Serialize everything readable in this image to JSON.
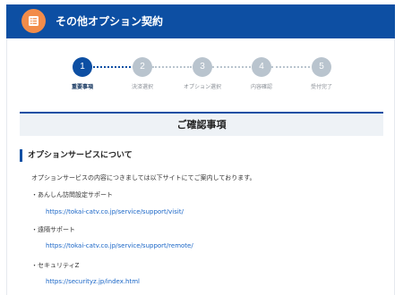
{
  "header": {
    "title": "その他オプション契約",
    "icon": "list-icon",
    "accent": "#0d4fa3",
    "icon_bg": "#f28c4a"
  },
  "steps": [
    {
      "number": "1",
      "label": "重要事項",
      "active": true
    },
    {
      "number": "2",
      "label": "決済選択",
      "active": false
    },
    {
      "number": "3",
      "label": "オプション選択",
      "active": false
    },
    {
      "number": "4",
      "label": "内容確認",
      "active": false
    },
    {
      "number": "5",
      "label": "受付完了",
      "active": false
    }
  ],
  "confirm": {
    "title": "ご確認事項"
  },
  "section": {
    "heading": "オプションサービスについて",
    "intro": "オプションサービスの内容につきましては以下サイトにてご案内しております。",
    "items": [
      {
        "label": "・あんしん訪問設定サポート",
        "url": "https://tokai-catv.co.jp/service/support/visit/"
      },
      {
        "label": "・遠隔サポート",
        "url": "https://tokai-catv.co.jp/service/support/remote/"
      },
      {
        "label": "・セキュリティZ",
        "url": "https://securityz.jp/index.html"
      }
    ]
  }
}
